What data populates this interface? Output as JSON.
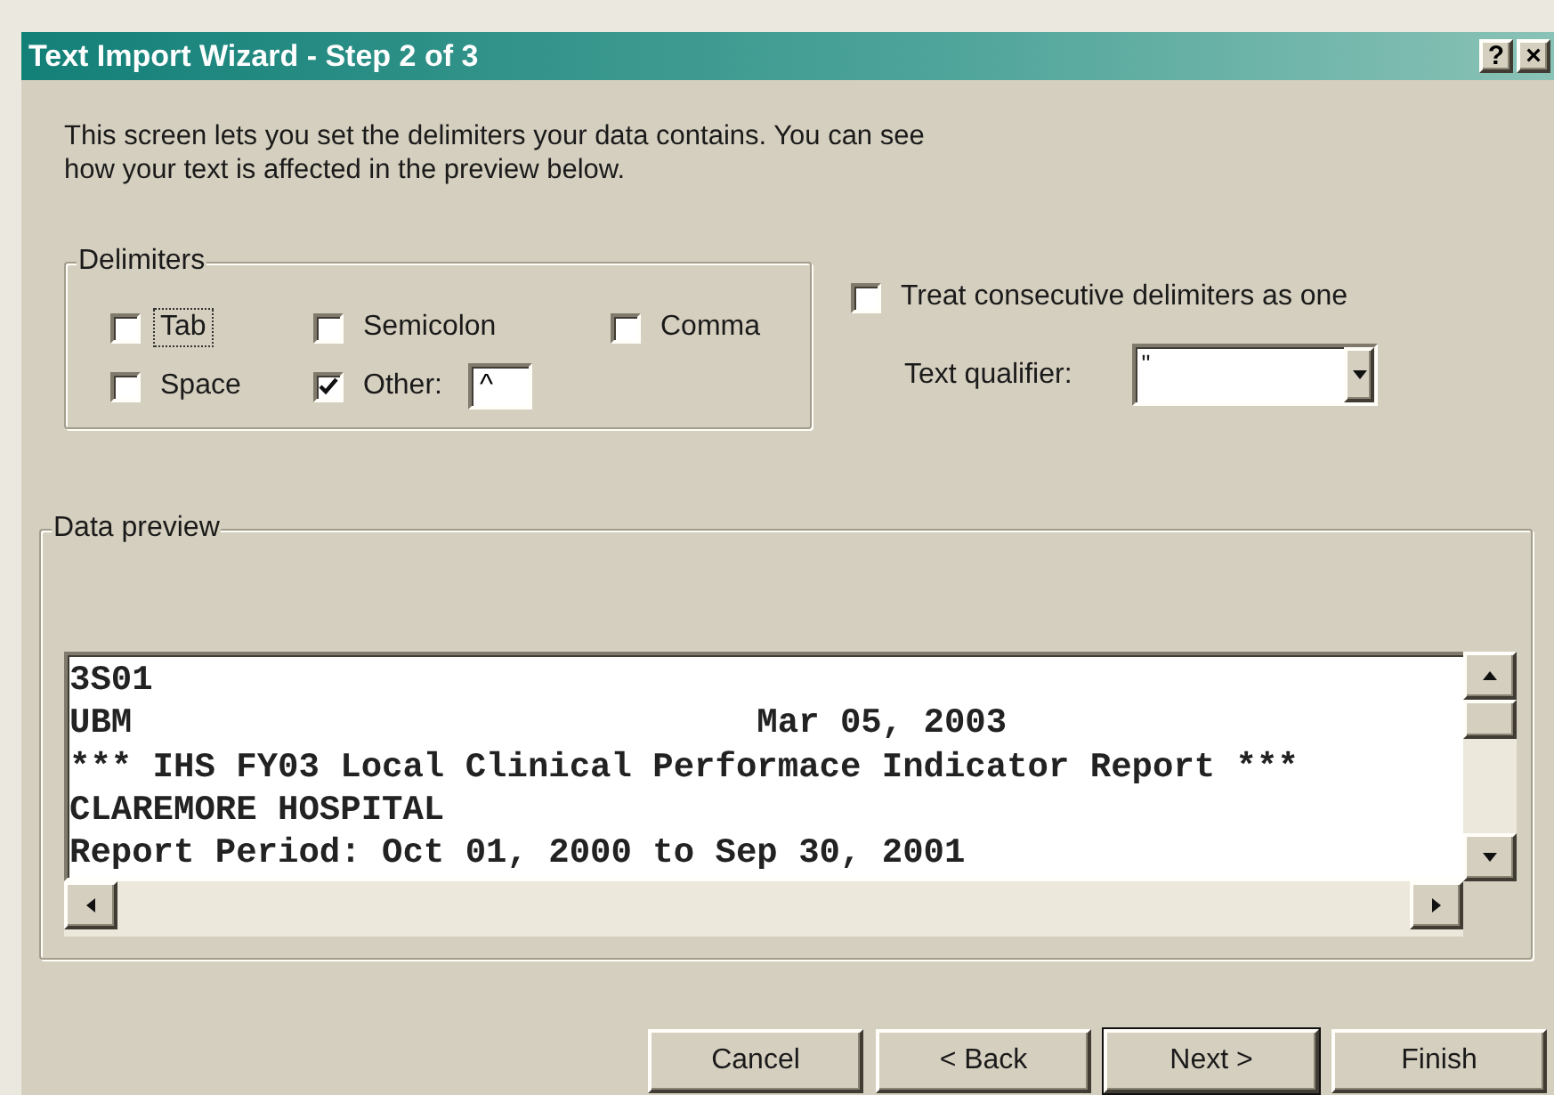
{
  "window": {
    "title": "Text Import Wizard - Step 2 of 3",
    "help_button": "?",
    "close_button": "×"
  },
  "intro_lines": [
    "This screen lets you set the delimiters your data contains.  You can see",
    "how your text is affected in the preview below."
  ],
  "delimiters": {
    "label": "Delimiters",
    "options": [
      {
        "label": "Tab",
        "checked": false,
        "focused": true
      },
      {
        "label": "Semicolon",
        "checked": false,
        "focused": false
      },
      {
        "label": "Comma",
        "checked": false,
        "focused": false
      },
      {
        "label": "Space",
        "checked": false,
        "focused": false
      },
      {
        "label": "Other:",
        "checked": true,
        "focused": false,
        "value": "^"
      }
    ]
  },
  "consecutive": {
    "label": "Treat consecutive delimiters as one",
    "checked": false
  },
  "text_qualifier": {
    "label": "Text qualifier:",
    "value": "\""
  },
  "preview": {
    "label": "Data preview",
    "lines": [
      "3S01",
      "UBM                              Mar 05, 2003",
      "*** IHS FY03 Local Clinical Performace Indicator Report ***",
      "CLAREMORE HOSPITAL",
      "Report Period: Oct 01, 2000 to Sep 30, 2001"
    ]
  },
  "buttons": [
    {
      "label": "Cancel",
      "default": false
    },
    {
      "label": "< Back",
      "default": false
    },
    {
      "label": "Next >",
      "default": true
    },
    {
      "label": "Finish",
      "default": false
    }
  ]
}
